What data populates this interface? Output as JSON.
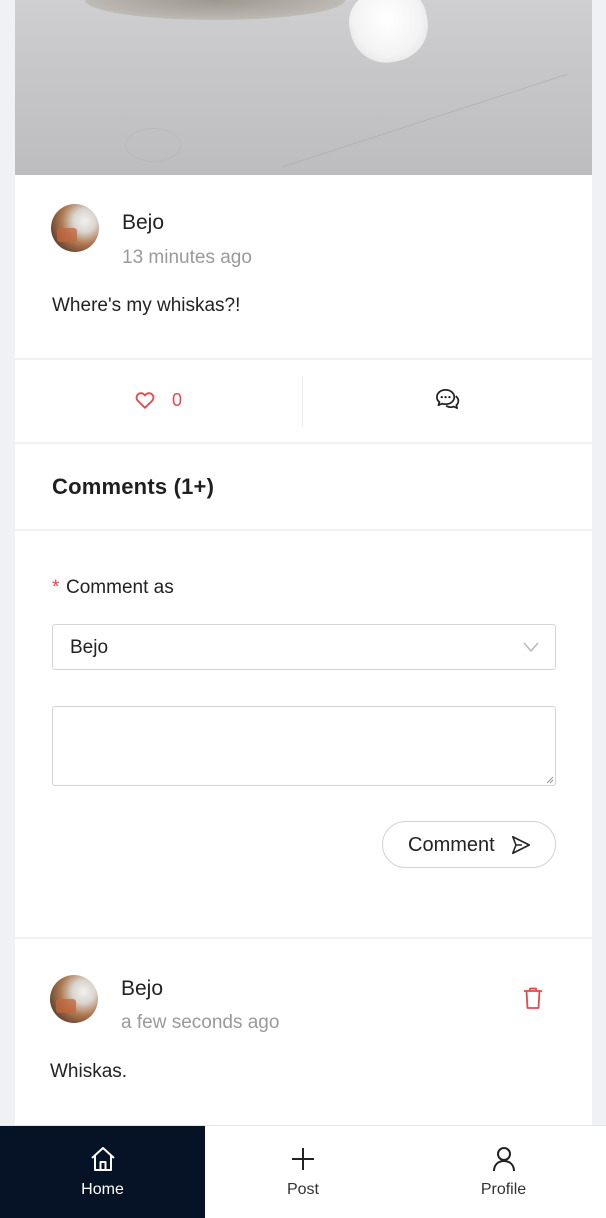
{
  "post": {
    "author": "Bejo",
    "time": "13 minutes ago",
    "text": "Where's my whiskas?!",
    "likes": "0"
  },
  "comments_section": {
    "title": "Comments (1+)",
    "required_marker": "*",
    "comment_as_label": "Comment as",
    "comment_as_value": "Bejo",
    "submit_label": "Comment"
  },
  "comment": {
    "author": "Bejo",
    "time": "a few seconds ago",
    "text": "Whiskas."
  },
  "nav": {
    "home": "Home",
    "post": "Post",
    "profile": "Profile"
  },
  "colors": {
    "accent_red": "#e5484d",
    "nav_active_bg": "#061326",
    "page_bg": "#f0f1f5"
  },
  "icons": [
    "heart-icon",
    "chat-icon",
    "chevron-down-icon",
    "send-icon",
    "trash-icon",
    "home-icon",
    "plus-icon",
    "user-icon"
  ]
}
